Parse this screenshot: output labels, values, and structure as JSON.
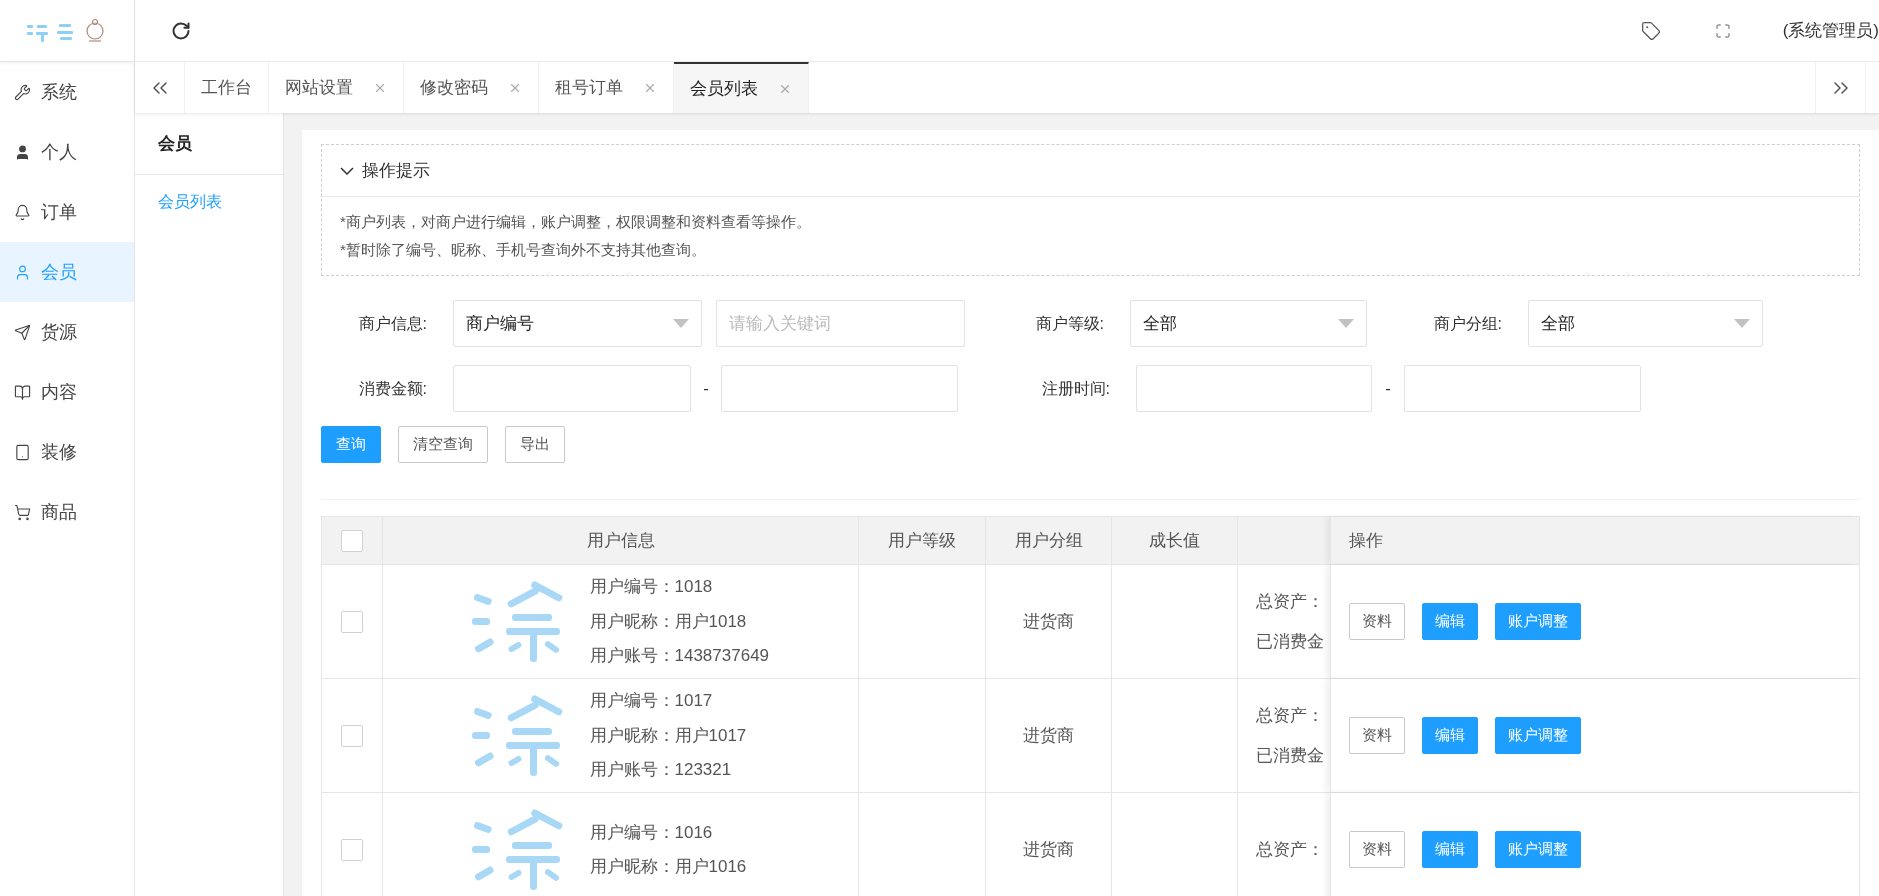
{
  "top_bar": {
    "user_role": "(系统管理员)"
  },
  "sidebar": {
    "items": [
      {
        "label": "系统",
        "selected": false
      },
      {
        "label": "个人",
        "selected": false
      },
      {
        "label": "订单",
        "selected": false
      },
      {
        "label": "会员",
        "selected": true
      },
      {
        "label": "货源",
        "selected": false
      },
      {
        "label": "内容",
        "selected": false
      },
      {
        "label": "装修",
        "selected": false
      },
      {
        "label": "商品",
        "selected": false
      }
    ]
  },
  "tabs": [
    {
      "label": "工作台",
      "closable": false,
      "selected": false
    },
    {
      "label": "网站设置",
      "closable": true,
      "selected": false
    },
    {
      "label": "修改密码",
      "closable": true,
      "selected": false
    },
    {
      "label": "租号订单",
      "closable": true,
      "selected": false
    },
    {
      "label": "会员列表",
      "closable": true,
      "selected": true
    }
  ],
  "sub_sidebar": {
    "title": "会员",
    "items": [
      {
        "label": "会员列表",
        "selected": true
      }
    ]
  },
  "hint": {
    "title": "操作提示",
    "expanded": true,
    "lines": [
      "*商户列表，对商户进行编辑，账户调整，权限调整和资料查看等操作。",
      "*暂时除了编号、昵称、手机号查询外不支持其他查询。"
    ]
  },
  "filters": {
    "merchant_info": {
      "label": "商户信息:",
      "select": "商户编号",
      "keyword_placeholder": "请输入关键词"
    },
    "merchant_level": {
      "label": "商户等级:",
      "select": "全部"
    },
    "merchant_group": {
      "label": "商户分组:",
      "select": "全部"
    },
    "spend_amount": {
      "label": "消费金额:",
      "separator": "-"
    },
    "register_time": {
      "label": "注册时间:",
      "separator": "-"
    }
  },
  "buttons": [
    {
      "label": "查询",
      "kind": "primary"
    },
    {
      "label": "清空查询",
      "kind": "default"
    },
    {
      "label": "导出",
      "kind": "default"
    }
  ],
  "table": {
    "header": {
      "checked": false,
      "user_info": "用户信息",
      "level": "用户等级",
      "group": "用户分组",
      "growth": "成长值",
      "actions": "操作"
    },
    "rows": [
      {
        "checked": false,
        "info_lines": [
          "用户编号：1018",
          "用户昵称：用户1018",
          "用户账号：1438737649"
        ],
        "group": "进货商",
        "assets_lines": [
          "总资产：",
          "已消费金"
        ],
        "actions": [
          {
            "label": "资料",
            "kind": "default"
          },
          {
            "label": "编辑",
            "kind": "primary"
          },
          {
            "label": "账户调整",
            "kind": "primary"
          }
        ]
      },
      {
        "checked": false,
        "info_lines": [
          "用户编号：1017",
          "用户昵称：用户1017",
          "用户账号：123321"
        ],
        "group": "进货商",
        "assets_lines": [
          "总资产：",
          "已消费金"
        ],
        "actions": [
          {
            "label": "资料",
            "kind": "default"
          },
          {
            "label": "编辑",
            "kind": "primary"
          },
          {
            "label": "账户调整",
            "kind": "primary"
          }
        ]
      },
      {
        "checked": false,
        "info_lines": [
          "用户编号：1016",
          "用户昵称：用户1016"
        ],
        "group": "进货商",
        "assets_lines": [
          "总资产："
        ],
        "actions": [
          {
            "label": "资料",
            "kind": "default"
          },
          {
            "label": "编辑",
            "kind": "primary"
          },
          {
            "label": "账户调整",
            "kind": "primary"
          }
        ]
      }
    ]
  }
}
